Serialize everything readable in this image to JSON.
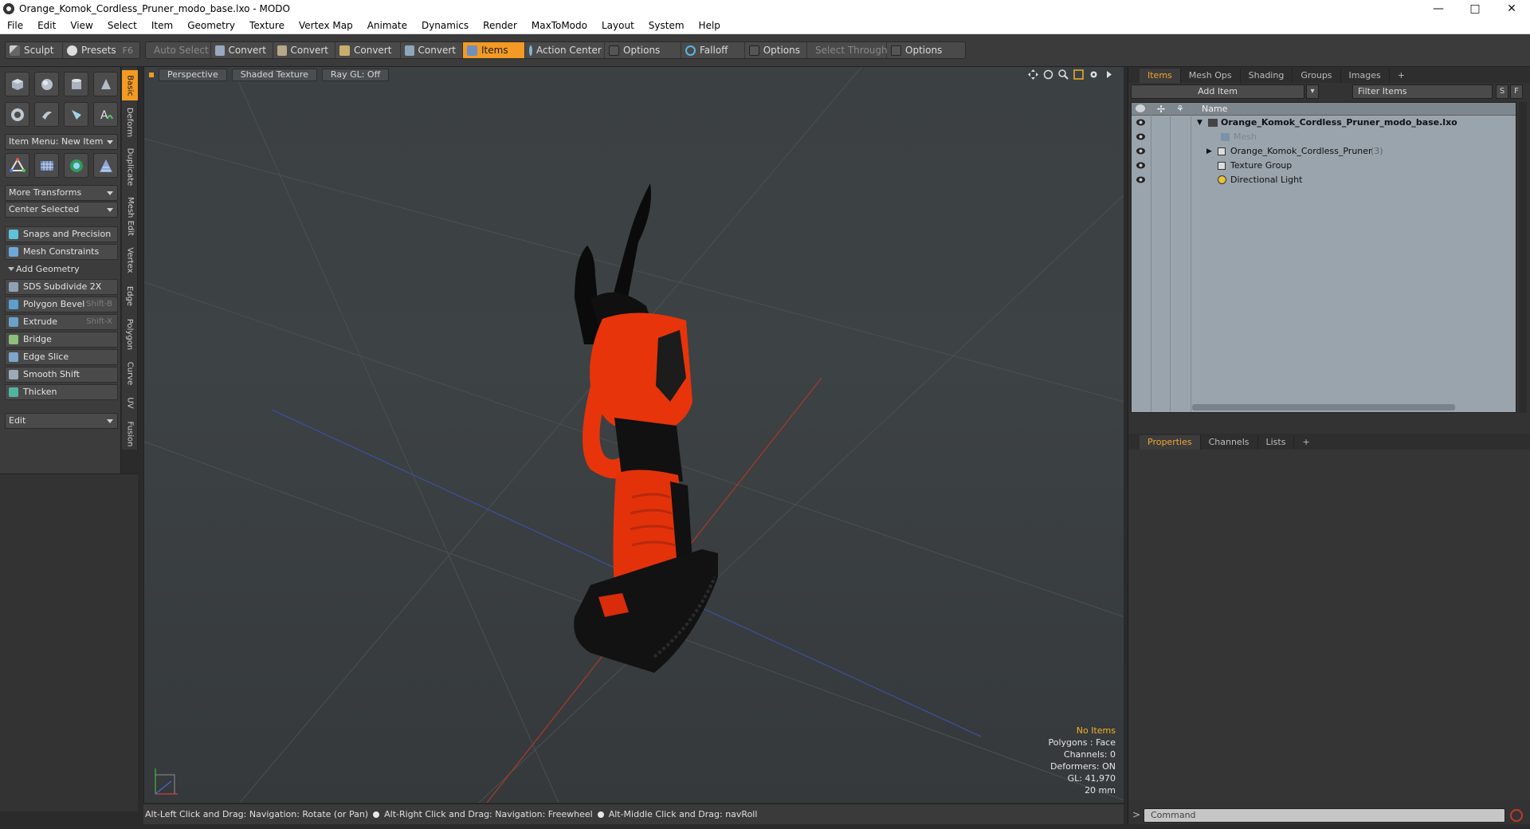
{
  "window": {
    "title": "Orange_Komok_Cordless_Pruner_modo_base.lxo - MODO",
    "controls": [
      "—",
      "□",
      "✕"
    ]
  },
  "menu": [
    "File",
    "Edit",
    "View",
    "Select",
    "Item",
    "Geometry",
    "Texture",
    "Vertex Map",
    "Animate",
    "Dynamics",
    "Render",
    "MaxToModo",
    "Layout",
    "System",
    "Help"
  ],
  "toolbar": {
    "sculpt": "Sculpt",
    "presets": "Presets",
    "presets_key": "F6",
    "auto_select": "Auto Select",
    "convert": "Convert",
    "items": "Items",
    "action_center": "Action Center",
    "options": "Options",
    "falloff": "Falloff",
    "select_through": "Select Through"
  },
  "toolbox": {
    "item_menu": "Item Menu: New Item",
    "more_transforms": "More Transforms",
    "center_selected": "Center Selected",
    "snaps": "Snaps and Precision",
    "mesh_constraints": "Mesh Constraints",
    "add_geometry": "Add Geometry",
    "tools": [
      {
        "label": "SDS Subdivide 2X",
        "key": ""
      },
      {
        "label": "Polygon Bevel",
        "key": "Shift-B"
      },
      {
        "label": "Extrude",
        "key": "Shift-X"
      },
      {
        "label": "Bridge",
        "key": ""
      },
      {
        "label": "Edge Slice",
        "key": ""
      },
      {
        "label": "Smooth Shift",
        "key": ""
      },
      {
        "label": "Thicken",
        "key": ""
      }
    ],
    "edit": "Edit"
  },
  "vtabs": [
    "Basic",
    "Deform",
    "Duplicate",
    "Mesh Edit",
    "Vertex",
    "Edge",
    "Polygon",
    "Curve",
    "UV",
    "Fusion"
  ],
  "viewport": {
    "view": "Perspective",
    "shading": "Shaded Texture",
    "raygl": "Ray GL: Off",
    "info": {
      "selection": "No Items",
      "polygons": "Polygons : Face",
      "channels": "Channels: 0",
      "deformers": "Deformers: ON",
      "gl": "GL: 41,970",
      "scale": "20 mm"
    }
  },
  "statusbar": {
    "hint1": "Alt-Left Click and Drag: Navigation: Rotate (or Pan)",
    "hint2": "Alt-Right Click and Drag: Navigation: Freewheel",
    "hint3": "Alt-Middle Click and Drag: navRoll"
  },
  "items_panel": {
    "tabs": [
      "Items",
      "Mesh Ops",
      "Shading",
      "Groups",
      "Images"
    ],
    "add_item": "Add Item",
    "filter": "Filter Items",
    "btn_s": "S",
    "btn_f": "F",
    "col_name": "Name",
    "rows": [
      {
        "label": "Orange_Komok_Cordless_Pruner_modo_base.lxo",
        "count": ""
      },
      {
        "label": "Mesh",
        "count": ""
      },
      {
        "label": "Orange_Komok_Cordless_Pruner",
        "count": "(3)"
      },
      {
        "label": "Texture Group",
        "count": ""
      },
      {
        "label": "Directional Light",
        "count": ""
      }
    ]
  },
  "properties_panel": {
    "tabs": [
      "Properties",
      "Channels",
      "Lists"
    ]
  },
  "command": {
    "placeholder": "Command"
  },
  "colors": {
    "accent": "#f29a24",
    "orange_body": "#e8340a",
    "viewport_bg": "#3b4042"
  }
}
